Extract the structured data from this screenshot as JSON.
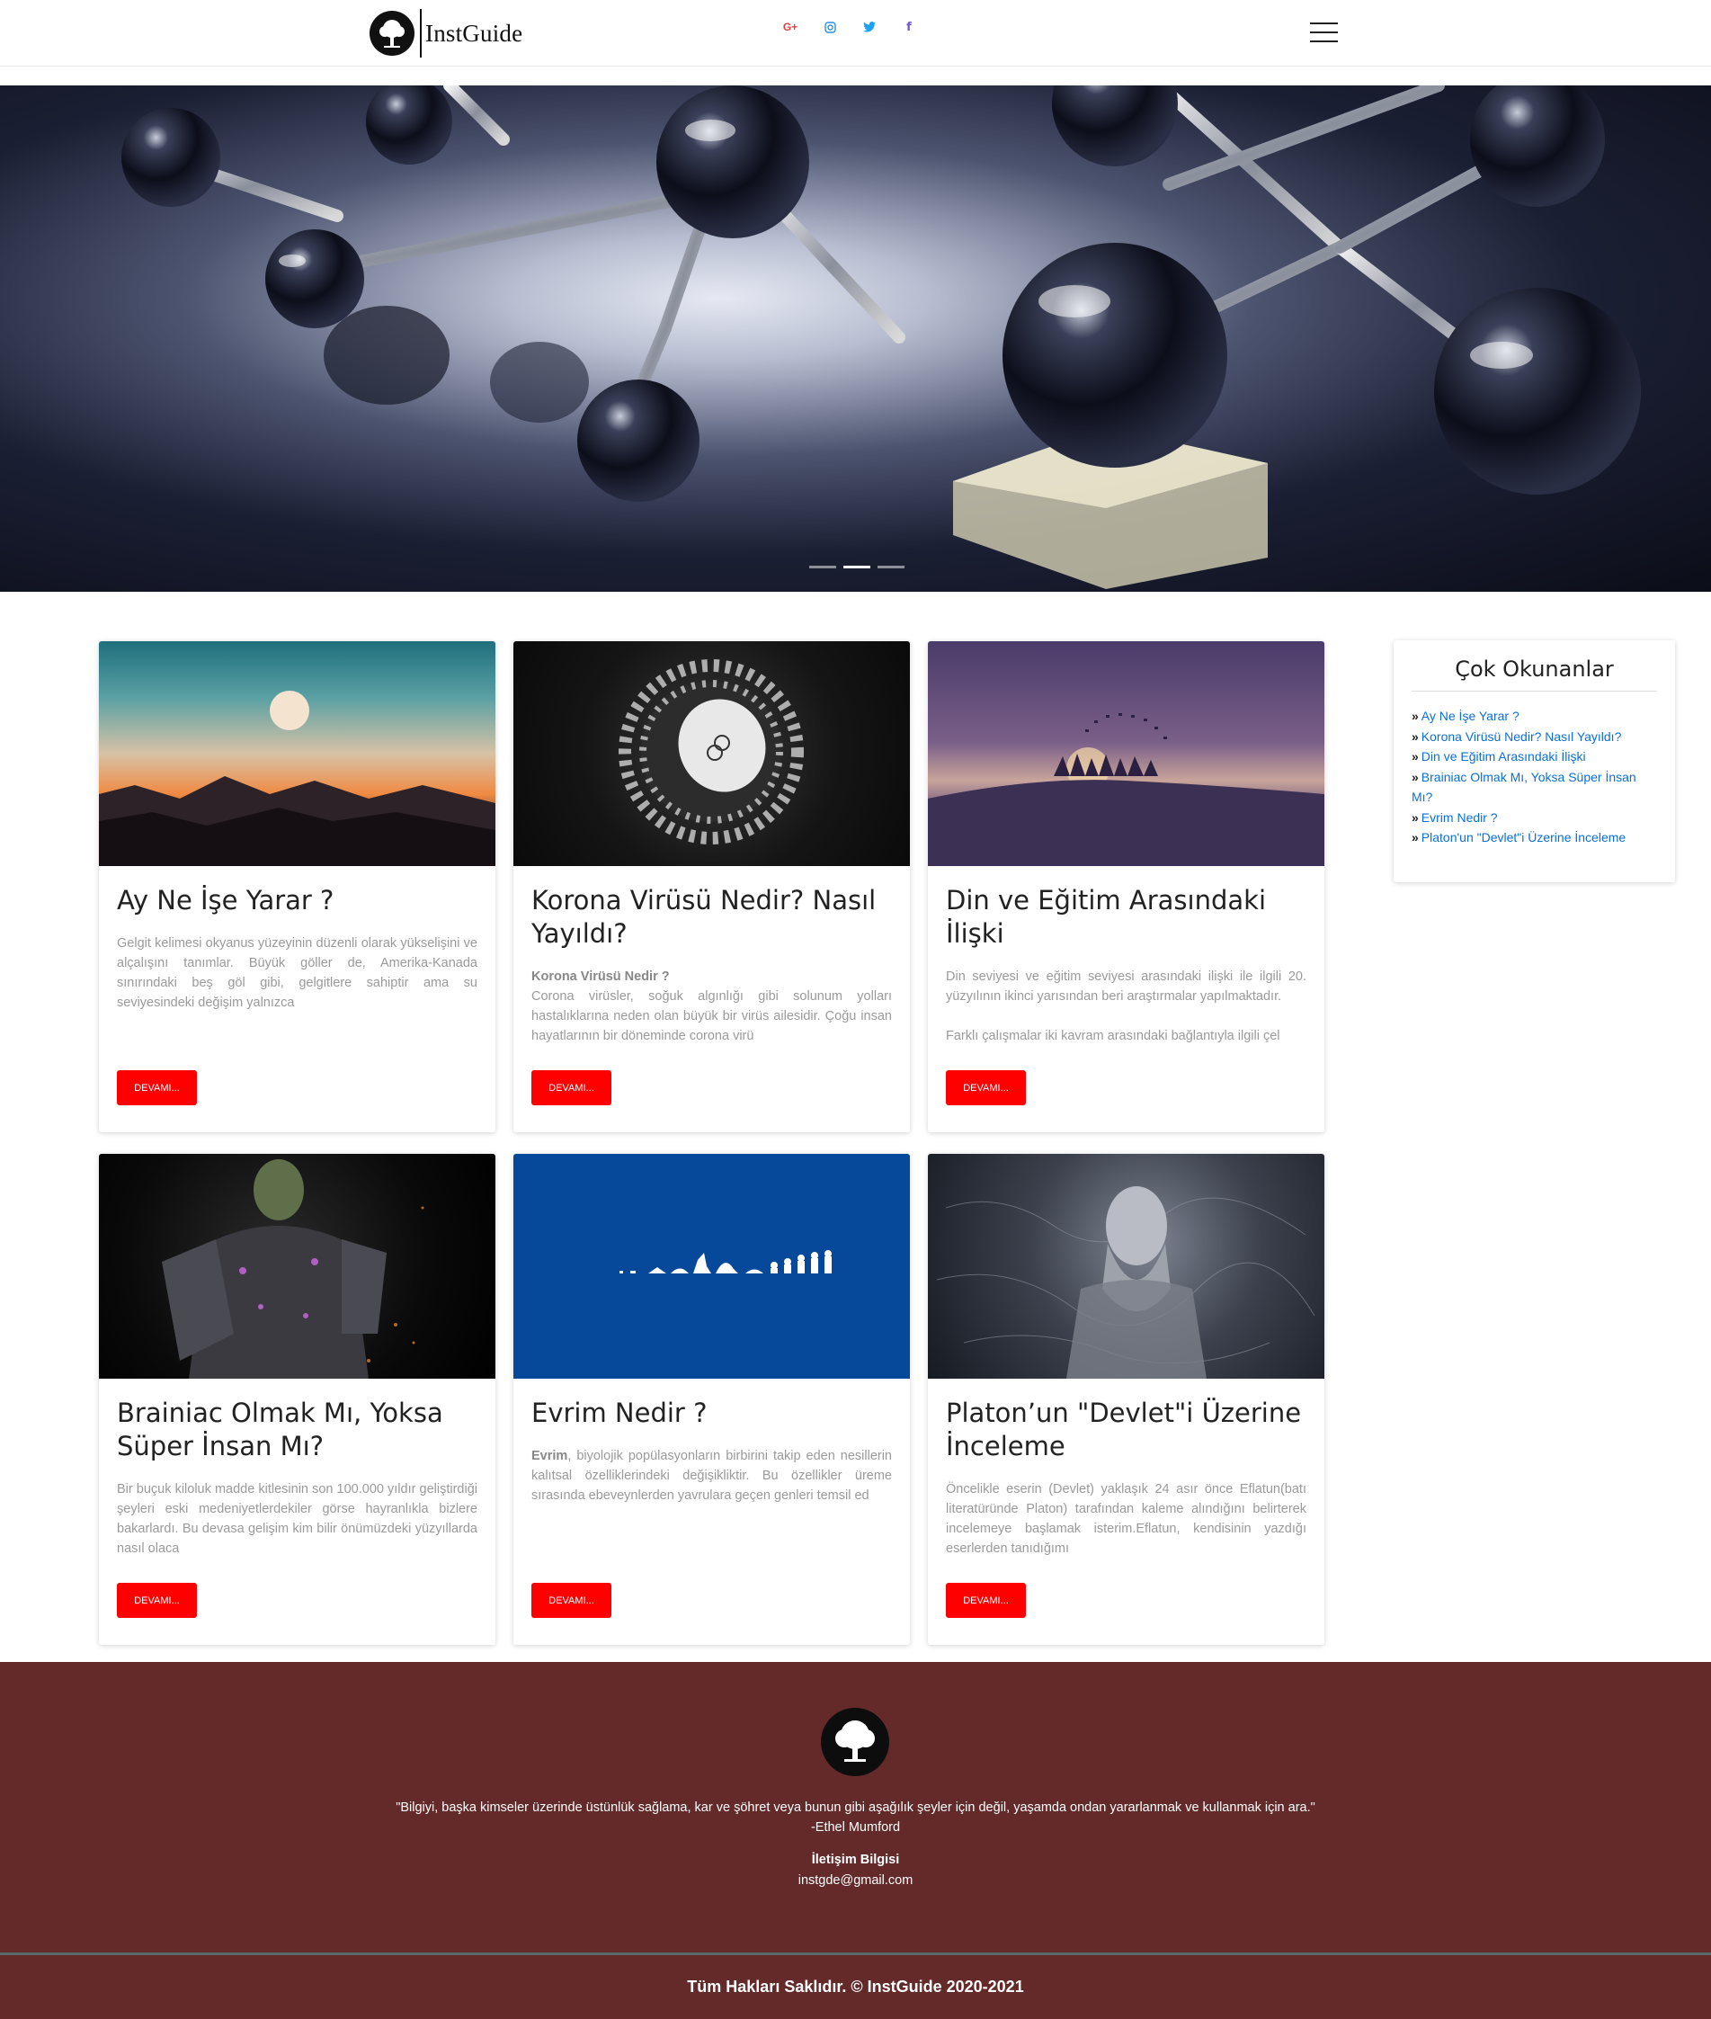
{
  "navbar": {
    "brand_name": "InstGuide",
    "socials": [
      {
        "icon": "google-plus-icon",
        "glyph": "G+",
        "color": "#e0433a"
      },
      {
        "icon": "instagram-icon",
        "glyph": "◎",
        "color": "#2d8fe0"
      },
      {
        "icon": "twitter-icon",
        "glyph": "🐦",
        "color": "#1da1f2"
      },
      {
        "icon": "facebook-icon",
        "glyph": "f",
        "color": "#6f56d9"
      }
    ]
  },
  "hero": {
    "slides": 3,
    "active_slide": 2
  },
  "cards": [
    {
      "title": "Ay Ne İşe Yarar ?",
      "subtitle": "",
      "text": "Gelgit kelimesi okyanus yüzeyinin düzenli olarak yükselişini ve alçalışını tanımlar. Büyük göller de, Amerika-Kanada sınırındaki beş göl gibi, gelgitlere sahiptir ama su seviyesindeki değişim yalnızca",
      "button": "DEVAMI..."
    },
    {
      "title": "Korona Virüsü Nedir? Nasıl Yayıldı?",
      "subtitle": "Korona Virüsü Nedir ?",
      "text": "Corona virüsler, soğuk algınlığı gibi solunum yolları hastalıklarına neden olan büyük bir virüs ailesidir. Çoğu insan hayatlarının bir döneminde corona virü",
      "button": "DEVAMI..."
    },
    {
      "title": "Din ve Eğitim Arasındaki İlişki",
      "subtitle": "",
      "text": "Din seviyesi ve eğitim seviyesi arasındaki ilişki ile ilgili 20. yüzyılının ikinci yarısından beri araştırmalar yapılmaktadır.",
      "text2": "Farklı çalışmalar iki kavram arasındaki bağlantıyla ilgili çel",
      "button": "DEVAMI..."
    },
    {
      "title": "Brainiac Olmak Mı, Yoksa Süper İnsan Mı?",
      "subtitle": "",
      "text": "Bir buçuk kiloluk madde kitlesinin son 100.000 yıldır geliştirdiği şeyleri eski medeniyetlerdekiler görse hayranlıkla bizlere bakarlardı. Bu devasa gelişim kim bilir önümüzdeki yüzyıllarda nasıl olaca",
      "button": "DEVAMI..."
    },
    {
      "title": "Evrim Nedir ?",
      "subtitle": "Evrim",
      "text": ", biyolojik popülasyonların birbirini takip eden nesillerin kalıtsal özelliklerindeki değişikliktir. Bu özellikler üreme sırasında ebeveynlerden yavrulara geçen genleri temsil ed",
      "button": "DEVAMI..."
    },
    {
      "title": "Platon’un \"Devlet\"i Üzerine İnceleme",
      "subtitle": "",
      "text": "Öncelikle eserin (Devlet) yaklaşık 24 asır önce Eflatun(batı literatüründe Platon) tarafından kaleme alındığını belirterek incelemeye başlamak isterim.Eflatun, kendisinin yazdığı eserlerden tanıdığımı",
      "button": "DEVAMI..."
    }
  ],
  "sidebar": {
    "title": "Çok Okunanlar",
    "items": [
      "Ay Ne İşe Yarar ?",
      "Korona Virüsü Nedir? Nasıl Yayıldı?",
      "Din ve Eğitim Arasındaki İlişki",
      "Brainiac Olmak Mı, Yoksa Süper İnsan Mı?",
      "Evrim Nedir ?",
      "Platon'un \"Devlet\"i Üzerine İnceleme"
    ]
  },
  "footer": {
    "quote": "\"Bilgiyi, başka kimseler üzerinde üstünlük sağlama, kar ve şöhret veya bunun gibi aşağılık şeyler için değil, yaşamda ondan yararlanmak ve kullanmak için ara.\"",
    "author": "-Ethel Mumford",
    "contact_title": "İletişim Bilgisi",
    "contact_email": "instgde@gmail.com",
    "copyright": "Tüm Hakları Saklıdır. © InstGuide 2020-2021"
  }
}
